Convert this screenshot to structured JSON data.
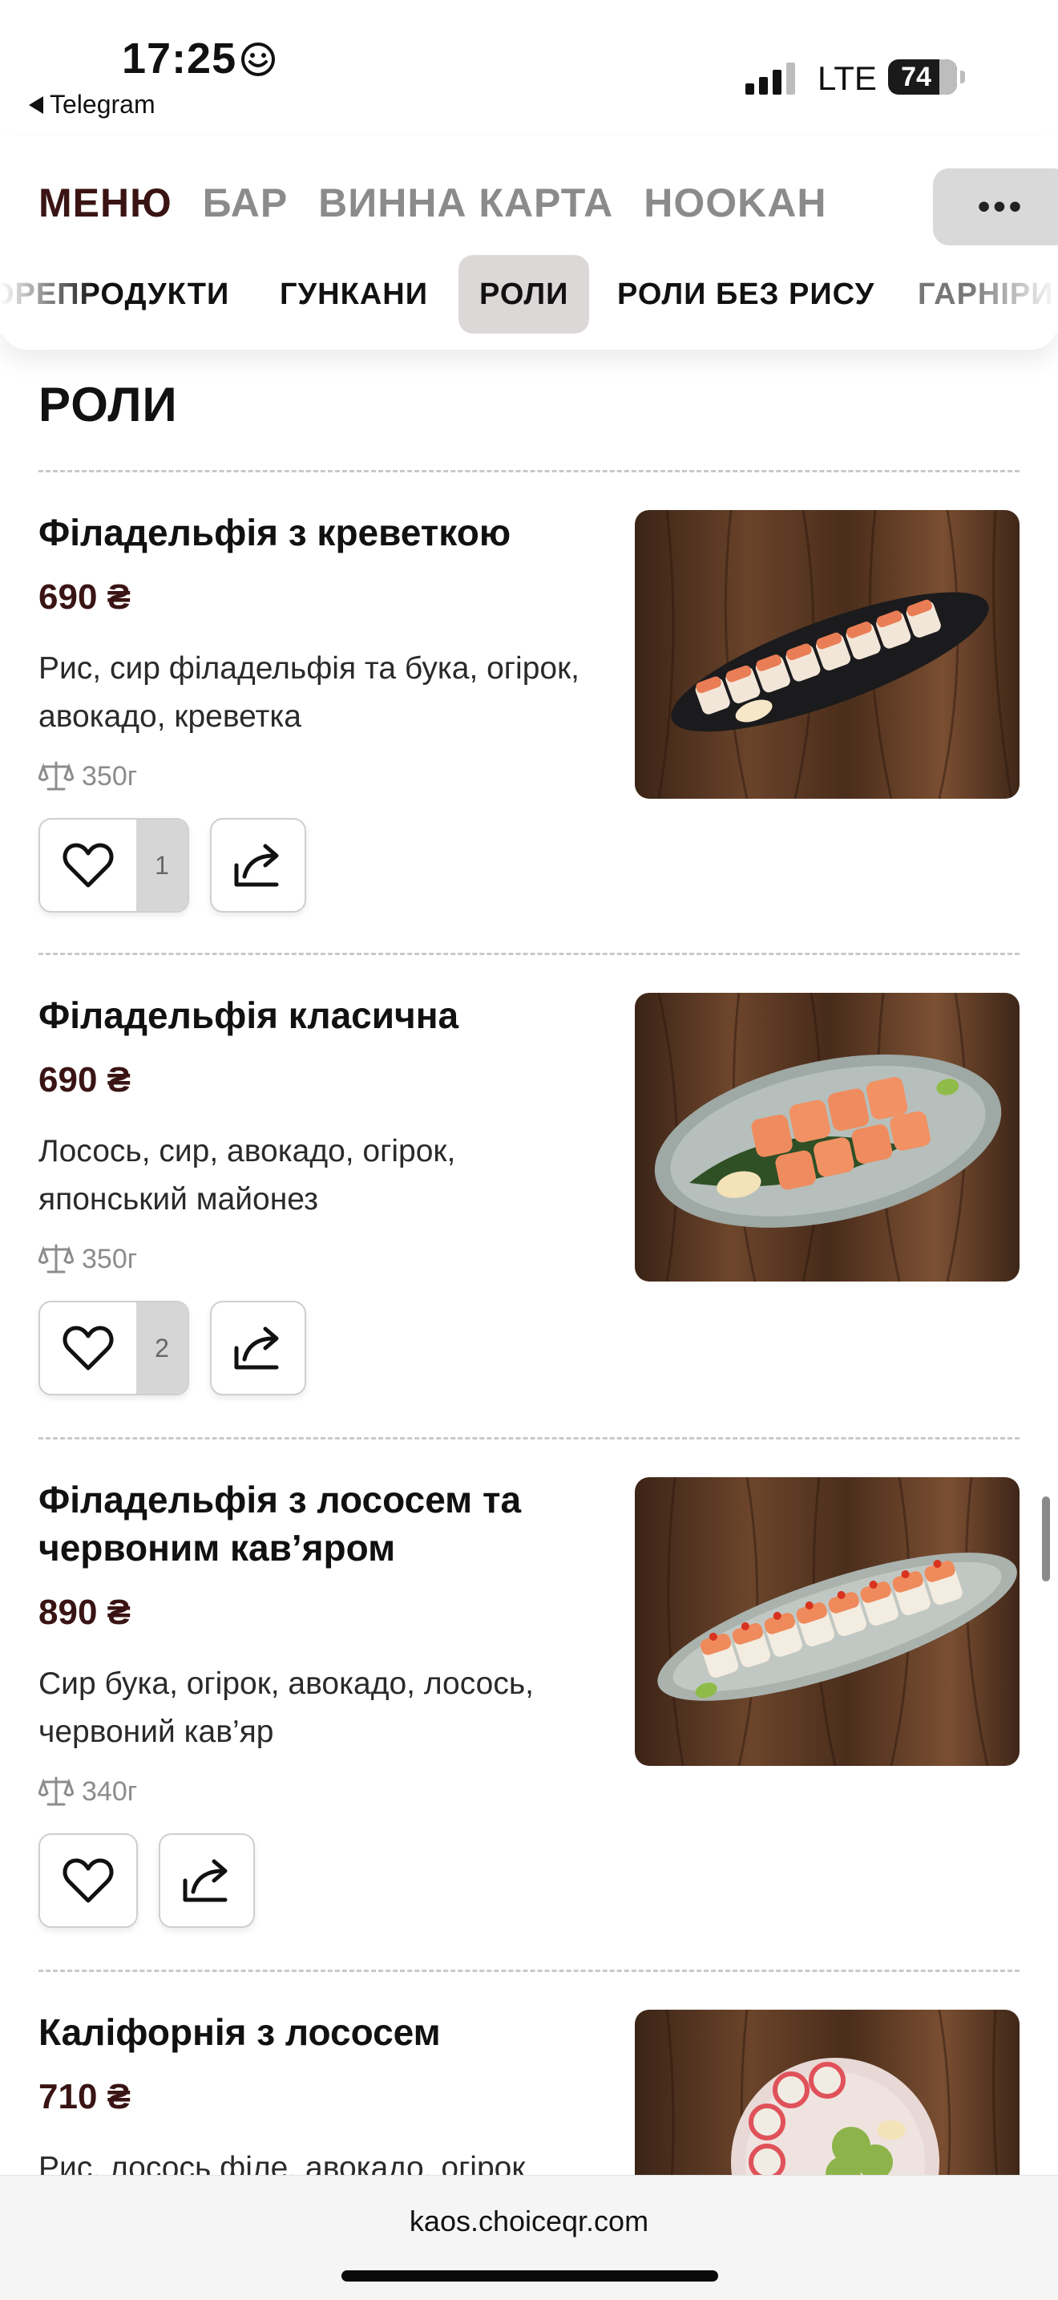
{
  "status_bar": {
    "time": "17:25",
    "back_app": "Telegram",
    "network": "LTE",
    "battery": "74"
  },
  "nav": {
    "main_tabs": [
      "МЕНЮ",
      "БАР",
      "ВИННА КАРТА",
      "HOOKAH"
    ],
    "more_label": "•••",
    "sub_tabs": [
      "ОРЕПРОДУКТИ",
      "ГУНКАНИ",
      "РОЛИ",
      "РОЛИ БЕЗ РИСУ",
      "ГАРНІРИ"
    ],
    "active_sub_tab": "РОЛИ"
  },
  "section": {
    "title": "РОЛИ"
  },
  "items": [
    {
      "name": "Філадельфія з креветкою",
      "price": "690 ₴",
      "description": "Рис, сир філадельфія та бука, огірок, авокадо, креветка",
      "weight": "350г",
      "likes": "1"
    },
    {
      "name": "Філадельфія класична",
      "price": "690 ₴",
      "description": "Лосось, сир, авокадо, огірок, японський майонез",
      "weight": "350г",
      "likes": "2"
    },
    {
      "name": "Філадельфія з лососем та червоним кав’яром",
      "price": "890 ₴",
      "description": "Сир бука, огірок, авокадо, лосось, червоний кав’яр",
      "weight": "340г",
      "likes": ""
    },
    {
      "name": "Каліфорнія з лососем",
      "price": "710 ₴",
      "description": "Рис, лосось філе, авокадо, огірок",
      "weight": "",
      "likes": ""
    }
  ],
  "browser": {
    "url": "kaos.choiceqr.com"
  },
  "colors": {
    "accent": "#3a1414",
    "muted_tab": "#8b8b8b",
    "active_chip": "#ddd8d8",
    "wood": "#5a3520"
  },
  "icons": [
    "smiley-icon",
    "back-triangle-icon",
    "signal-icon",
    "heart-icon",
    "share-icon",
    "scale-icon"
  ]
}
